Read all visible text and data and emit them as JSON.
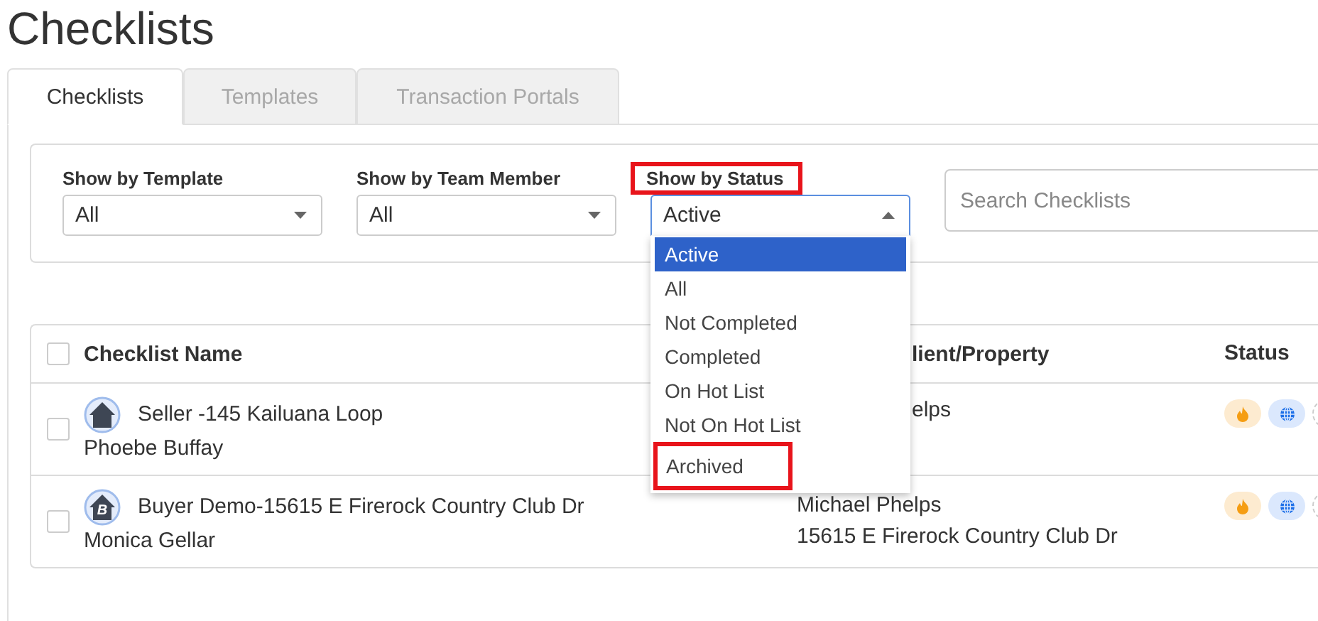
{
  "page": {
    "title": "Checklists"
  },
  "tabs": [
    {
      "label": "Checklists",
      "selected": true
    },
    {
      "label": "Templates",
      "selected": false
    },
    {
      "label": "Transaction Portals",
      "selected": false
    }
  ],
  "filters": [
    {
      "label": "Show by Template",
      "value": "All",
      "open": false,
      "highlighted": false
    },
    {
      "label": "Show by Team Member",
      "value": "All",
      "open": false,
      "highlighted": false
    },
    {
      "label": "Show by Status",
      "value": "Active",
      "open": true,
      "highlighted": true
    }
  ],
  "status_options": [
    {
      "label": "Active",
      "selected": true,
      "highlighted": false
    },
    {
      "label": "All",
      "selected": false,
      "highlighted": false
    },
    {
      "label": "Not Completed",
      "selected": false,
      "highlighted": false
    },
    {
      "label": "Completed",
      "selected": false,
      "highlighted": false
    },
    {
      "label": "On Hot List",
      "selected": false,
      "highlighted": false
    },
    {
      "label": "Not On Hot List",
      "selected": false,
      "highlighted": false
    },
    {
      "label": "Archived",
      "selected": false,
      "highlighted": true
    }
  ],
  "search": {
    "placeholder": "Search Checklists"
  },
  "table": {
    "all_checked": false,
    "columns": [
      "Checklist Name",
      "lient/Property",
      "Status"
    ],
    "rows": [
      {
        "checked": false,
        "icon_letter": "",
        "name": "Seller -145 Kailuana Loop",
        "owner": "Phoebe Buffay",
        "client": "elps",
        "property": "",
        "badges": [
          {
            "kind": "hot"
          },
          {
            "kind": "web"
          },
          {
            "kind": "more"
          }
        ]
      },
      {
        "checked": false,
        "icon_letter": "B",
        "name": "Buyer Demo-15615 E Firerock Country Club Dr",
        "owner": "Monica Gellar",
        "client": "Michael Phelps",
        "property": "15615 E Firerock Country Club Dr",
        "badges": [
          {
            "kind": "hot"
          },
          {
            "kind": "web"
          },
          {
            "kind": "more"
          }
        ]
      }
    ]
  }
}
